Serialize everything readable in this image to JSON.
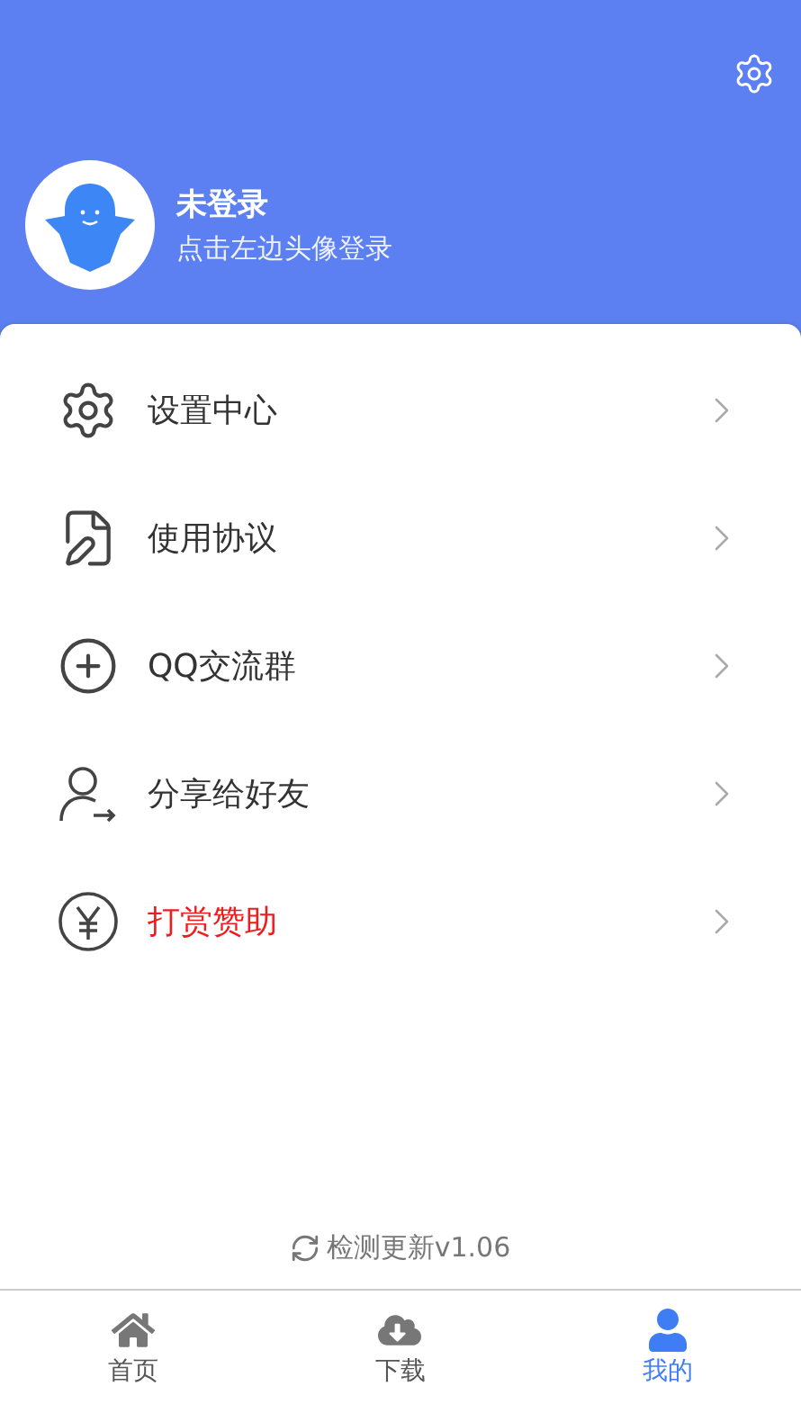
{
  "header": {
    "username": "未登录",
    "hint": "点击左边头像登录"
  },
  "menu": [
    {
      "label": "设置中心",
      "kind": "settings",
      "color": "#333333"
    },
    {
      "label": "使用协议",
      "kind": "agreement",
      "color": "#333333"
    },
    {
      "label": "QQ交流群",
      "kind": "group",
      "color": "#333333"
    },
    {
      "label": "分享给好友",
      "kind": "share",
      "color": "#333333"
    },
    {
      "label": "打赏赞助",
      "kind": "donate",
      "color": "#ee1c1c"
    }
  ],
  "update": {
    "label": "检测更新v1.06"
  },
  "tabs": [
    {
      "label": "首页",
      "kind": "home",
      "selected": false
    },
    {
      "label": "下载",
      "kind": "download",
      "selected": false
    },
    {
      "label": "我的",
      "kind": "me",
      "selected": true
    }
  ]
}
